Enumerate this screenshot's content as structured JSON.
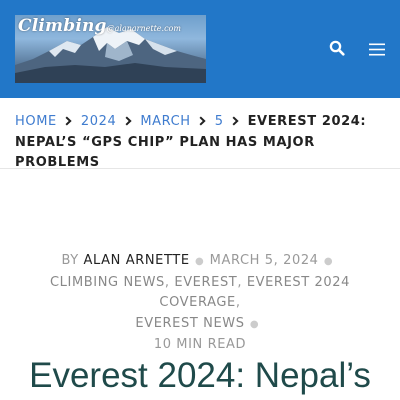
{
  "header": {
    "logo_text": "Climbing",
    "logo_sub": "@alanarnette.com",
    "bg_color": "#2277c8",
    "search_icon": "search-icon",
    "menu_icon": "hamburger-menu-icon"
  },
  "breadcrumb": {
    "items": [
      "HOME",
      "2024",
      "MARCH",
      "5"
    ],
    "current": "EVEREST 2024: NEPAL’S “GPS CHIP” PLAN HAS MAJOR PROBLEMS",
    "separator_icon": "chevron-right-icon"
  },
  "meta": {
    "by": "BY",
    "author": "ALAN ARNETTE",
    "date": "MARCH 5, 2024",
    "categories": [
      "CLIMBING NEWS",
      "EVEREST",
      "EVEREST 2024 COVERAGE",
      "EVEREST NEWS"
    ],
    "read_time": "10 MIN READ"
  },
  "post": {
    "title": "Everest 2024: Nepal’s"
  }
}
